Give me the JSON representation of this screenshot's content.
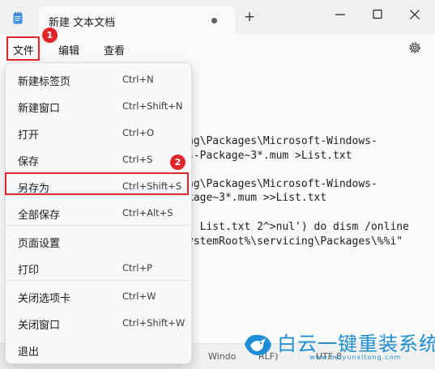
{
  "window": {
    "tab_title": "新建 文本文档",
    "new_tab_label": "+"
  },
  "menubar": {
    "file": "文件",
    "edit": "编辑",
    "view": "查看"
  },
  "annotations": {
    "marker_1": "1",
    "marker_2": "2",
    "highlight_color": "#e0262b"
  },
  "editor": {
    "lines": [
      "ng\\Packages\\Microsoft-Windows-",
      "s-Package~3*.mum >List.txt",
      "ng\\Packages\\Microsoft-Windows-",
      "kage~3*.mum >>List.txt",
      ". List.txt 2^>nul') do dism /online",
      "ystemRoot%\\servicing\\Packages\\%%i\""
    ]
  },
  "file_menu": {
    "items": [
      {
        "label": "新建标签页",
        "shortcut": "Ctrl+N"
      },
      {
        "label": "新建窗口",
        "shortcut": "Ctrl+Shift+N"
      },
      {
        "label": "打开",
        "shortcut": "Ctrl+O"
      },
      {
        "label": "保存",
        "shortcut": "Ctrl+S"
      },
      {
        "label": "另存为",
        "shortcut": "Ctrl+Shift+S"
      },
      {
        "label": "全部保存",
        "shortcut": "Ctrl+Alt+S"
      },
      {
        "label": "页面设置",
        "shortcut": ""
      },
      {
        "label": "打印",
        "shortcut": "Ctrl+P"
      },
      {
        "label": "关闭选项卡",
        "shortcut": "Ctrl+W"
      },
      {
        "label": "关闭窗口",
        "shortcut": "Ctrl+Shift+W"
      },
      {
        "label": "退出",
        "shortcut": ""
      }
    ]
  },
  "statusbar": {
    "line_ending": "Windo",
    "line_ending_tail": "RLF)",
    "encoding": "UTF-8"
  },
  "watermark": {
    "title": "白云一键重装系统",
    "url": "www.baiyunxitong.com",
    "color": "#1e8fd6"
  }
}
